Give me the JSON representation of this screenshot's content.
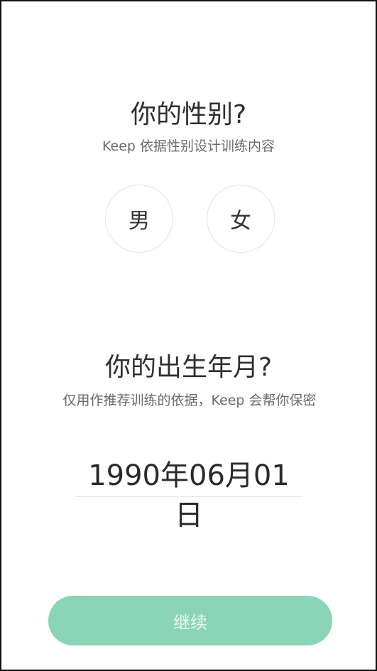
{
  "gender_section": {
    "title": "你的性别?",
    "subtitle": "Keep 依据性别设计训练内容",
    "options": {
      "male": "男",
      "female": "女"
    }
  },
  "birth_section": {
    "title": "你的出生年月?",
    "subtitle": "仅用作推荐训练的依据，Keep 会帮你保密",
    "date_value": "1990年06月01日"
  },
  "footer": {
    "continue_label": "继续"
  },
  "colors": {
    "accent": "#8ad4b7",
    "button_text": "#e9f7f1"
  }
}
